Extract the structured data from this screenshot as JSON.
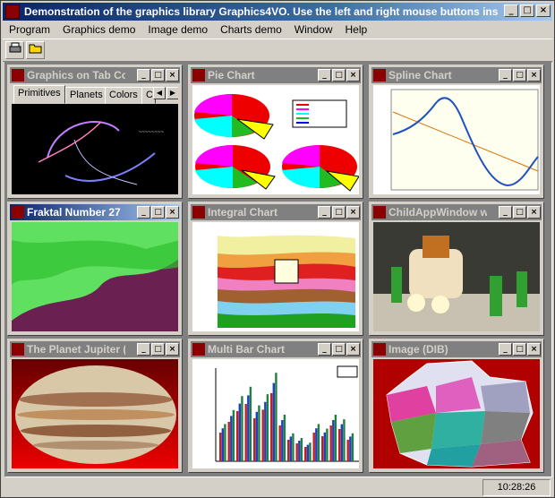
{
  "app": {
    "title": "Demonstration of the graphics library Graphics4VO.  Use the left and right mouse buttons insi...",
    "clock": "10:28:26"
  },
  "menu": [
    "Program",
    "Graphics demo",
    "Image demo",
    "Charts demo",
    "Window",
    "Help"
  ],
  "windows": [
    {
      "title": "Graphics on Tab Co...",
      "tabs": [
        "Primitives",
        "Planets",
        "Colors",
        "C"
      ]
    },
    {
      "title": "Pie Chart"
    },
    {
      "title": "Spline Chart"
    },
    {
      "title": "Fraktal Number 27"
    },
    {
      "title": "Integral Chart"
    },
    {
      "title": "ChildAppWindow wit"
    },
    {
      "title": "The Planet Jupiter ("
    },
    {
      "title": "Multi Bar Chart"
    },
    {
      "title": "Image (DIB)"
    }
  ],
  "colors": {
    "active_title": "#0a246a",
    "inactive_title": "#808080"
  }
}
